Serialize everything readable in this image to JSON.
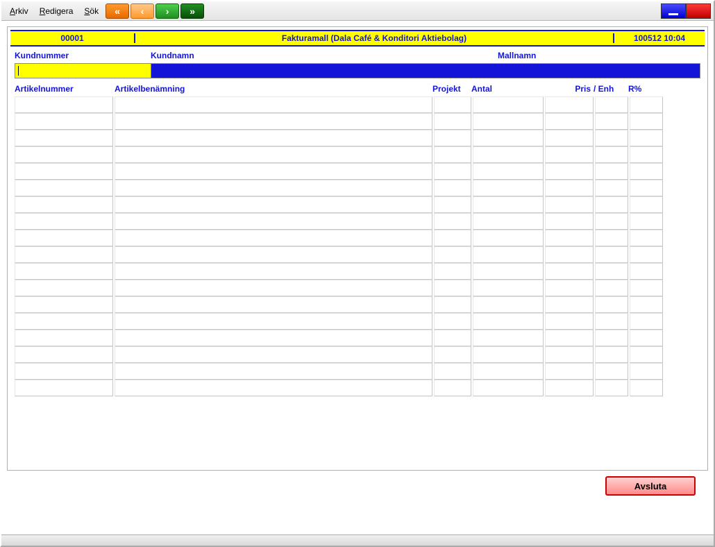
{
  "menu": {
    "arkiv": "Arkiv",
    "redigera": "Redigera",
    "sok": "Sök"
  },
  "nav": {
    "first": "«",
    "prev": "‹",
    "next": "›",
    "last": "»"
  },
  "header": {
    "code": "00001",
    "title": "Fakturamall (Dala Café & Konditori Aktiebolag)",
    "timestamp": "100512 10:04"
  },
  "fields": {
    "kundnummer_label": "Kundnummer",
    "kundnamn_label": "Kundnamn",
    "mallnamn_label": "Mallnamn",
    "kundnummer_value": ""
  },
  "columns": {
    "artikelnummer": "Artikelnummer",
    "artikelbenamning": "Artikelbenämning",
    "projekt": "Projekt",
    "antal": "Antal",
    "pris": "Pris",
    "enh": "/ Enh",
    "rpct": "R%"
  },
  "grid": {
    "row_count": 18
  },
  "buttons": {
    "avsluta": "Avsluta"
  }
}
